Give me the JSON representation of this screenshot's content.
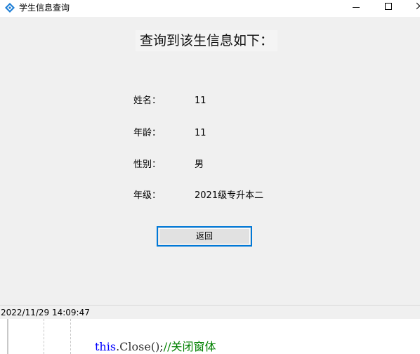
{
  "window": {
    "title": "学生信息查询",
    "icon": "blue-diamond-app-icon",
    "controls": [
      "minimize-icon",
      "maximize-icon",
      "close-icon"
    ]
  },
  "main": {
    "heading": "查询到该生信息如下：",
    "fields": [
      {
        "label": "姓名：",
        "value": "11"
      },
      {
        "label": "年龄：",
        "value": "11"
      },
      {
        "label": "性别：",
        "value": "男"
      },
      {
        "label": "年级：",
        "value": "2021级专升本二"
      }
    ],
    "back_button": "返回"
  },
  "statusbar": {
    "timestamp": "2022/11/29 14:09:47"
  },
  "editor": {
    "keyword": "this",
    "code": ".Close();",
    "comment": "//关闭窗体"
  },
  "colors": {
    "accent": "#0078d7",
    "window_bg": "#f0f0f0",
    "button_bg": "#e1e1e1",
    "code_keyword": "#0000ff",
    "code_comment": "#008000"
  }
}
